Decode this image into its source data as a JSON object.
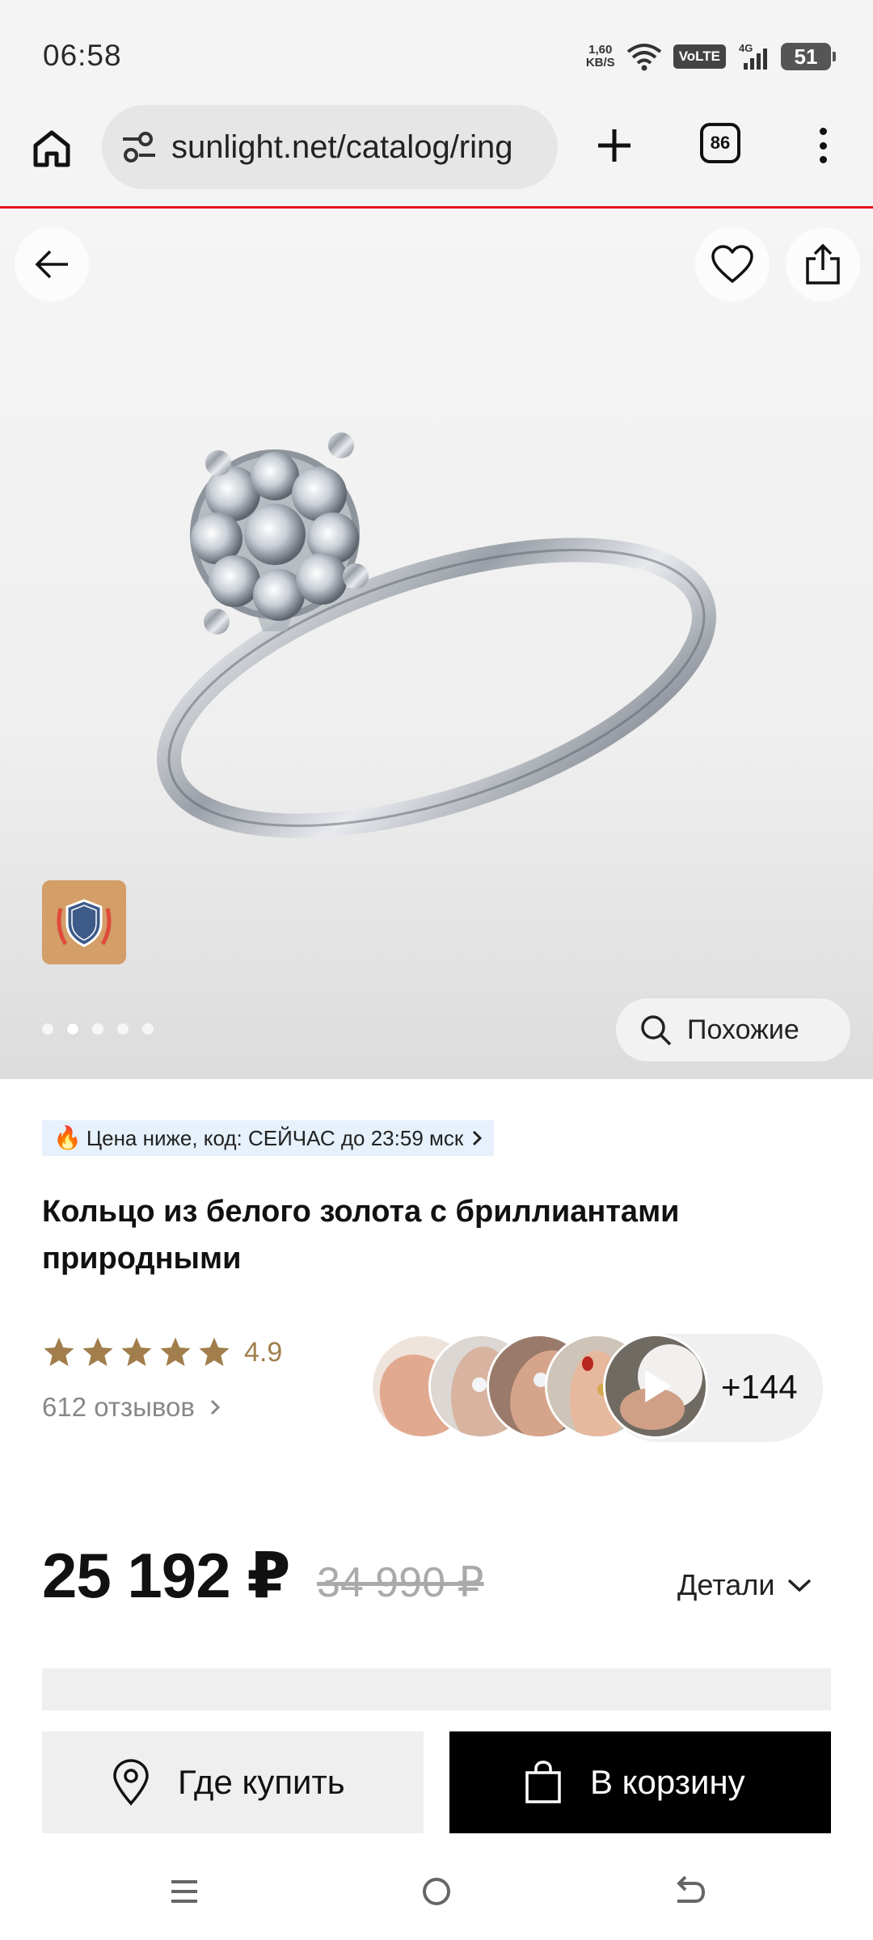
{
  "status_bar": {
    "time": "06:58",
    "net_speed_value": "1,60",
    "net_speed_unit": "KB/S",
    "volte": "VoLTE",
    "network": "4G",
    "battery": "51"
  },
  "browser": {
    "url": "sunlight.net/catalog/ring",
    "tab_count": "86"
  },
  "gallery": {
    "image_count": 5,
    "active_index": 1,
    "similar_label": "Похожие"
  },
  "product": {
    "promo_icon": "🔥",
    "promo_text": "Цена ниже, код: СЕЙЧАС до 23:59 мск",
    "title": "Кольцо из белого золота с бриллиантами природными",
    "rating": "4.9",
    "stars": 5,
    "reviews_label": "612 отзывов",
    "ugc_more": "+144",
    "price": "25 192 ₽",
    "old_price": "34 990 ₽",
    "details_label": "Детали"
  },
  "actions": {
    "where_to_buy": "Где купить",
    "add_to_cart": "В корзину"
  },
  "colors": {
    "accent_red": "#e2141b",
    "star_gold": "#a17e4c",
    "promo_bg": "#e6f1fb",
    "cart_bg": "#000000"
  }
}
